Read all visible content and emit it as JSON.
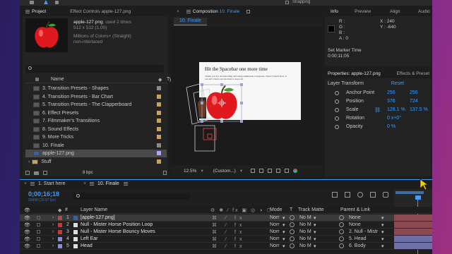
{
  "top_toolbar": {
    "snapping_label": "Snapping"
  },
  "project": {
    "tab_label": "Project",
    "effect_controls_tab": "Effect Controls apple-127.png",
    "file_name": "apple-127.png",
    "file_used": ", used 2 times",
    "file_dims": "512 x 512 (1.00)",
    "file_colors": "Millions of Colors+ (Straight)",
    "file_scan": "non-interlaced",
    "search_placeholder": "",
    "col_name": "Name",
    "col_type": "Type",
    "items": [
      {
        "label": "3. Transition Presets - Shapes",
        "color": "#8a8a8a"
      },
      {
        "label": "4. Transition Presets - Bar Chart",
        "color": "#c8a15a"
      },
      {
        "label": "5. Transition Presets - The Clapperboard",
        "color": "#c8a15a"
      },
      {
        "label": "6. Effect Presets",
        "color": "#c8a15a"
      },
      {
        "label": "7. Filmmaker's Transitions",
        "color": "#c8a15a"
      },
      {
        "label": "8. Sound Effects",
        "color": "#c8a15a"
      },
      {
        "label": "9. More Tricks",
        "color": "#c8a15a"
      },
      {
        "label": "10. Finale",
        "color": "#8a8a8a"
      },
      {
        "label": "apple-127.png",
        "color": "#a8a8ff"
      },
      {
        "label": "Stuff",
        "color": "#c8a15a"
      }
    ],
    "bpc_label": "8 bpc"
  },
  "composition": {
    "tab_label": "Composition",
    "tab_comp_name": "10. Finale",
    "subtab_label": "10. Finale",
    "doc_title": "Hit the Spacebar one more time",
    "doc_body": "Thank you for downloading and using Animation Composer. There's much more it can do! Check our tutorials to learn all.",
    "zoom": "12.5%",
    "resolution": "(Custom...)"
  },
  "info": {
    "tabs": [
      "Info",
      "Preview",
      "Align",
      "Audio"
    ],
    "r_label": "R :",
    "g_label": "G :",
    "b_label": "B :",
    "a_label": "A : 0",
    "x_label": "X : 240",
    "y_label": "Y : -640",
    "marker_title": "Set Marker Time",
    "marker_time": "0;00;11;05"
  },
  "properties": {
    "tab_label": "Properties: apple-127.png",
    "effects_tab": "Effects & Preset",
    "section": "Layer Transform",
    "reset": "Reset",
    "rows": [
      {
        "label": "Anchor Point",
        "v1": "256",
        "v2": "256"
      },
      {
        "label": "Position",
        "v1": "376",
        "v2": "724"
      },
      {
        "label": "Scale",
        "v1": "128.1 %",
        "v2": "137.5 %"
      },
      {
        "label": "Rotation",
        "v1": "0 x+0°",
        "v2": ""
      },
      {
        "label": "Opacity",
        "v1": "0 %",
        "v2": ""
      }
    ]
  },
  "timeline": {
    "tabs": [
      {
        "label": "1. Start here"
      },
      {
        "label": "10. Finale"
      }
    ],
    "timecode": "0;00;16;18",
    "fps": "00498 (29.97 fps)",
    "col_layer_name": "Layer Name",
    "col_mode": "Mode",
    "col_t": "T",
    "col_track_matte": "Track Matte",
    "col_parent": "Parent & Link",
    "layers": [
      {
        "num": "1",
        "name": "[apple-127.png]",
        "color": "#a05050",
        "mode": "Norr",
        "matte": "No M",
        "parent": "None"
      },
      {
        "num": "2",
        "name": "Null - Mister Horse Position Loop",
        "color": "#c23a3a",
        "mode": "Norr",
        "matte": "No M",
        "parent": "None"
      },
      {
        "num": "3",
        "name": "Null - Mister Horse Bouncy Moves",
        "color": "#c23a3a",
        "mode": "Norr",
        "matte": "No M",
        "parent": "2. Null - Mistr"
      },
      {
        "num": "4",
        "name": "Left Ear",
        "color": "#8d8dd6",
        "mode": "Norr",
        "matte": "No M",
        "parent": "5. Head"
      },
      {
        "num": "5",
        "name": "Head",
        "color": "#8d8dd6",
        "mode": "Norr",
        "matte": "No M",
        "parent": "6. Body"
      }
    ]
  }
}
